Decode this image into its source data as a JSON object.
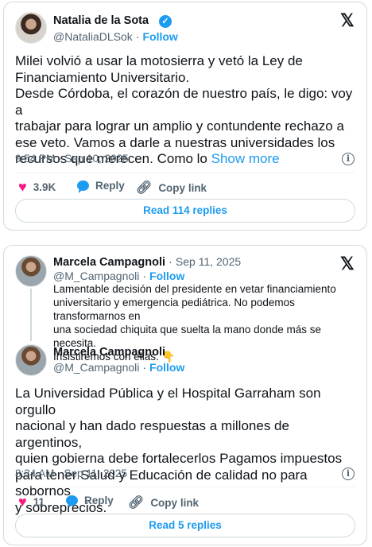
{
  "tweet1": {
    "author": "Natalia de la Sota",
    "handle": "@NataliaDLSok",
    "follow": "Follow",
    "lines": [
      "Milei volvió a usar la motosierra y vetó la Ley de",
      "Financiamiento Universitario.",
      "Desde Córdoba, el corazón de nuestro país, le digo: voy a",
      "trabajar para lograr un amplio y contundente rechazo a",
      "ese veto. Vamos a darle a nuestras universidades los",
      "recursos que merecen. Como lo"
    ],
    "show_more": "Show more",
    "timestamp": "9:54 PM · Sep 10, 2025",
    "likes": "3.9K",
    "reply": "Reply",
    "copy_link": "Copy link",
    "read_replies": "Read 114 replies"
  },
  "tweet2": {
    "quoted": {
      "author": "Marcela Campagnoli",
      "date": "Sep 11, 2025",
      "handle": "@M_Campagnoli",
      "follow": "Follow",
      "lines": [
        "Lamentable decisión del presidente en vetar financiamiento",
        "universitario y emergencia pediátrica. No podemos transformarnos en",
        "una sociedad chiquita que suelta la mano donde más se necesita.",
        "Insistiremos con ellas. 👇"
      ]
    },
    "author": "Marcela Campagnoli",
    "handle": "@M_Campagnoli",
    "follow": "Follow",
    "lines": [
      "La Universidad Pública y el Hospital Garraham son orgullo",
      "nacional y han dado respuestas a millones de argentinos,",
      "quien gobierna debe fortalecerlos Pagamos impuestos",
      "para tener Salud y Educación de calidad no para sobornos",
      "y sobreprecios."
    ],
    "timestamp": "8:34 AM · Sep 11, 2025",
    "likes": "11",
    "reply": "Reply",
    "copy_link": "Copy link",
    "read_replies": "Read 5 replies"
  },
  "colors": {
    "accent": "#1d9bf0",
    "like": "#f91880",
    "muted": "#536471"
  },
  "icons": [
    "verified-badge-icon",
    "x-logo-icon",
    "info-icon",
    "heart-icon",
    "reply-bubble-icon",
    "link-icon",
    "point-down-emoji"
  ]
}
